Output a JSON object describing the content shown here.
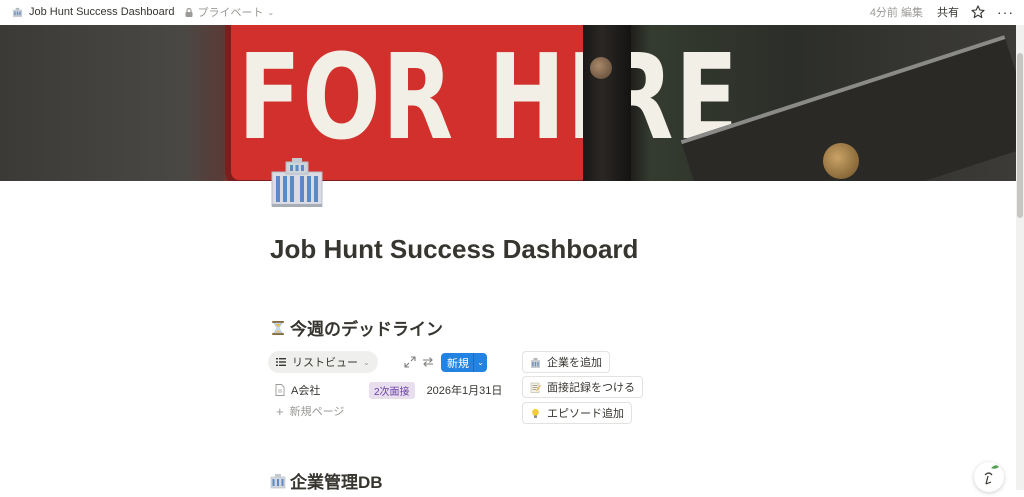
{
  "topbar": {
    "page_title": "Job Hunt Success Dashboard",
    "privacy": "プライベート",
    "edited": "4分前 編集",
    "share": "共有"
  },
  "cover": {
    "sign_text": "FOR HIRE"
  },
  "page": {
    "title": "Job Hunt Success Dashboard"
  },
  "deadlines": {
    "heading": "今週のデッドライン",
    "view_name": "リストビュー",
    "new_button": "新規",
    "rows": [
      {
        "title": "A会社",
        "stage": "2次面接",
        "date": "2026年1月31日"
      }
    ],
    "new_page": "新規ページ"
  },
  "actions": [
    {
      "label": "企業を追加",
      "icon": "office-building-icon"
    },
    {
      "label": "面接記録をつける",
      "icon": "memo-icon"
    },
    {
      "label": "エピソード追加",
      "icon": "lightbulb-icon"
    }
  ],
  "company_db": {
    "heading": "企業管理DB"
  },
  "colors": {
    "accent": "#2383e2",
    "tag_bg": "#e8deee",
    "tag_text": "#6940a5",
    "text": "#37352f",
    "muted": "#9b9a97"
  }
}
